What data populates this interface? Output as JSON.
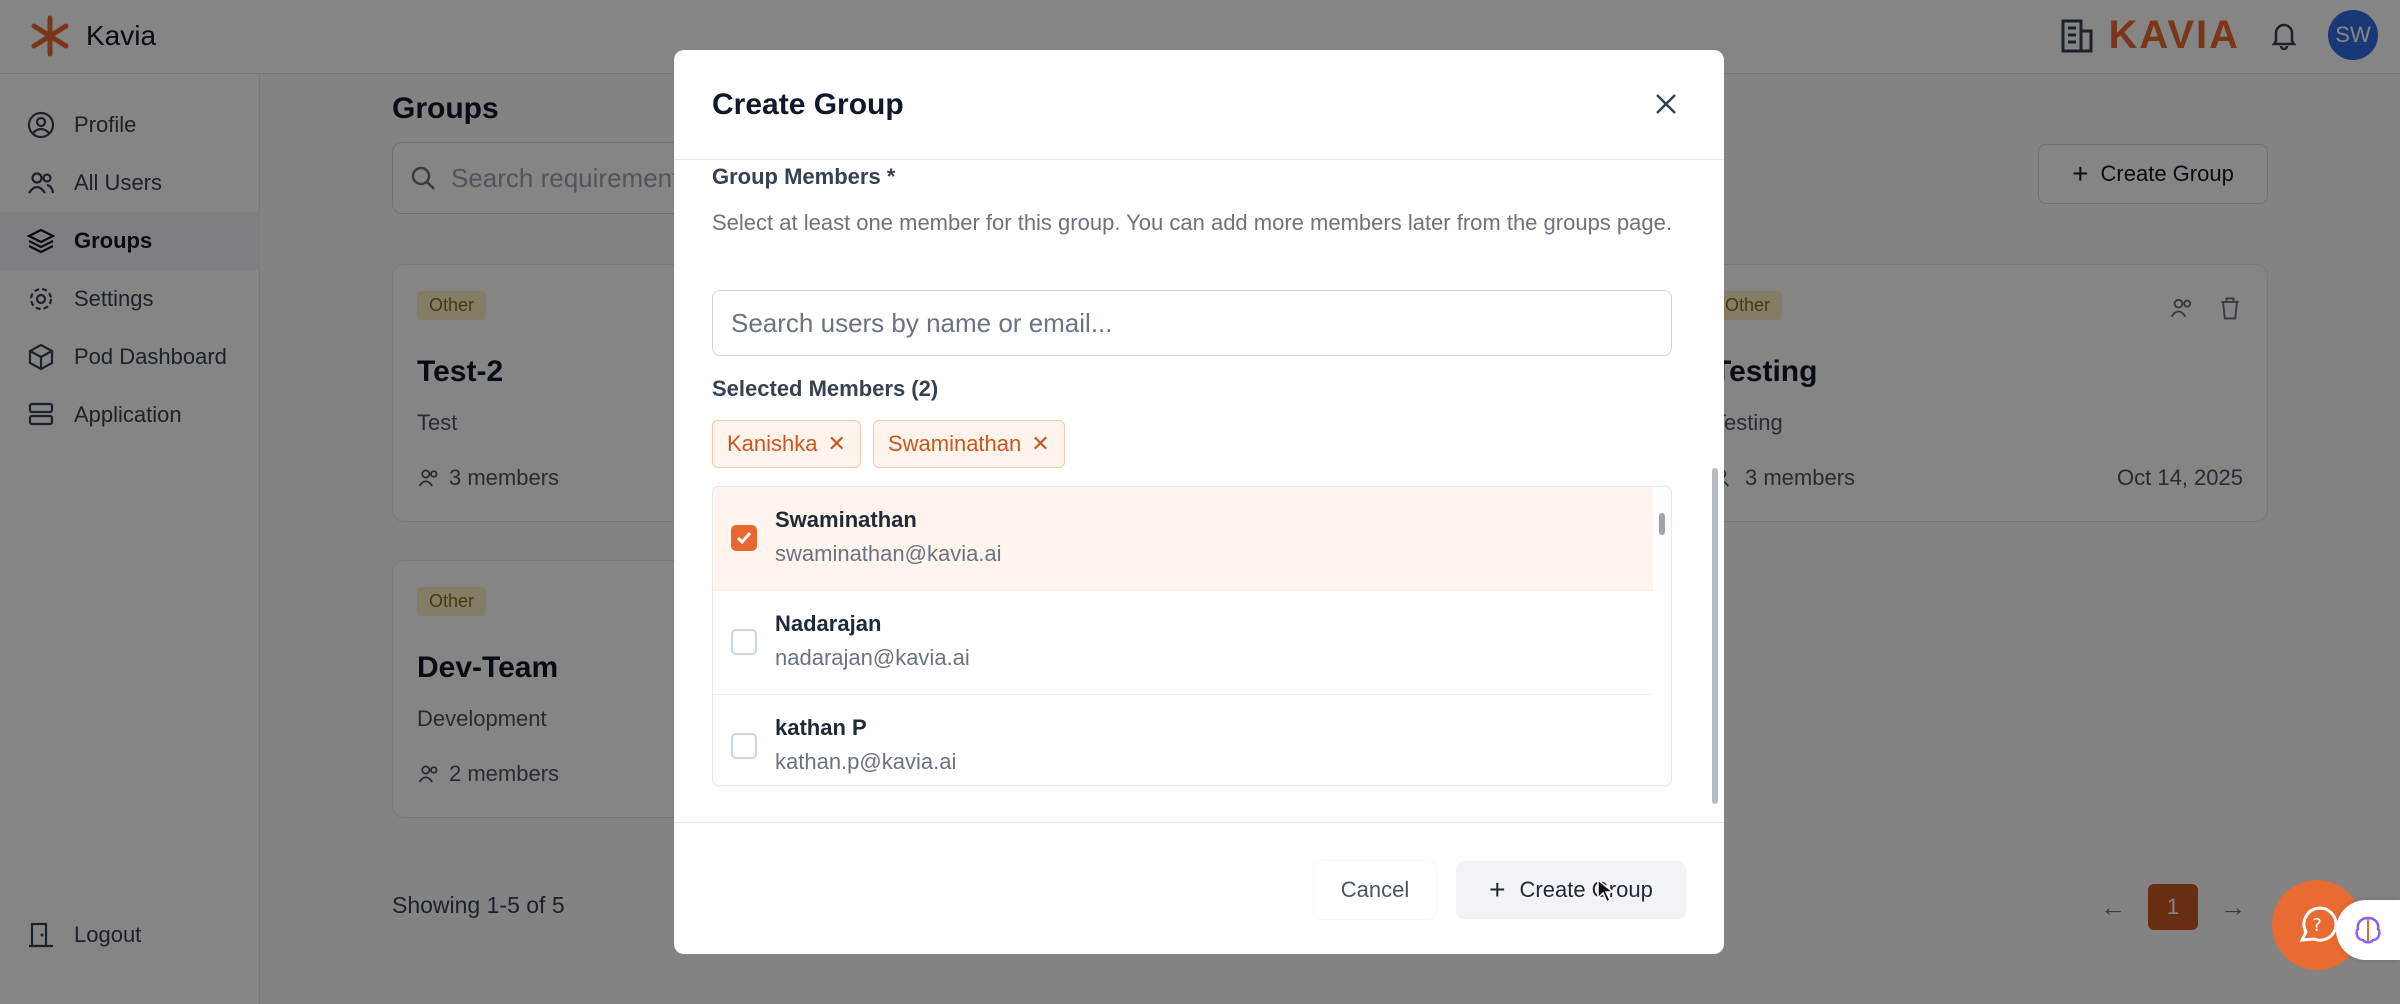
{
  "topbar": {
    "brand_name": "Kavia",
    "logo_text": "KAVIA",
    "avatar_initials": "SW",
    "accent_color": "#e8692f"
  },
  "sidebar": {
    "items": [
      {
        "label": "Profile",
        "icon": "user-circle-icon"
      },
      {
        "label": "All Users",
        "icon": "users-icon"
      },
      {
        "label": "Groups",
        "icon": "layers-icon",
        "active": true
      },
      {
        "label": "Settings",
        "icon": "gear-icon"
      },
      {
        "label": "Pod Dashboard",
        "icon": "cube-icon"
      },
      {
        "label": "Application",
        "icon": "server-icon"
      }
    ],
    "logout_label": "Logout"
  },
  "main": {
    "page_title": "Groups",
    "search_placeholder": "Search requirements",
    "create_button": "Create Group",
    "cards": [
      {
        "badge": "Other",
        "title": "Test-2",
        "description": "Test",
        "members": "3 members"
      },
      {
        "badge": "Other",
        "title": "Testing",
        "description": "Testing",
        "members": "3 members",
        "date": "Oct 14, 2025"
      },
      {
        "badge": "Other",
        "title": "Dev-Team",
        "description": "Development",
        "members": "2 members"
      }
    ],
    "showing_text": "Showing 1-5 of 5",
    "pager": {
      "prev": "←",
      "current": "1",
      "next": "→"
    }
  },
  "modal": {
    "title": "Create Group",
    "members_label": "Group Members *",
    "members_help": "Select at least one member for this group. You can add more members later from the groups page.",
    "search_placeholder": "Search users by name or email...",
    "selected_label": "Selected Members (2)",
    "chips": [
      "Kanishka",
      "Swaminathan"
    ],
    "users": [
      {
        "name": "Swaminathan",
        "email": "swaminathan@kavia.ai",
        "checked": true
      },
      {
        "name": "Nadarajan",
        "email": "nadarajan@kavia.ai",
        "checked": false
      },
      {
        "name": "kathan P",
        "email": "kathan.p@kavia.ai",
        "checked": false
      }
    ],
    "cancel_label": "Cancel",
    "create_label": "Create Group"
  }
}
